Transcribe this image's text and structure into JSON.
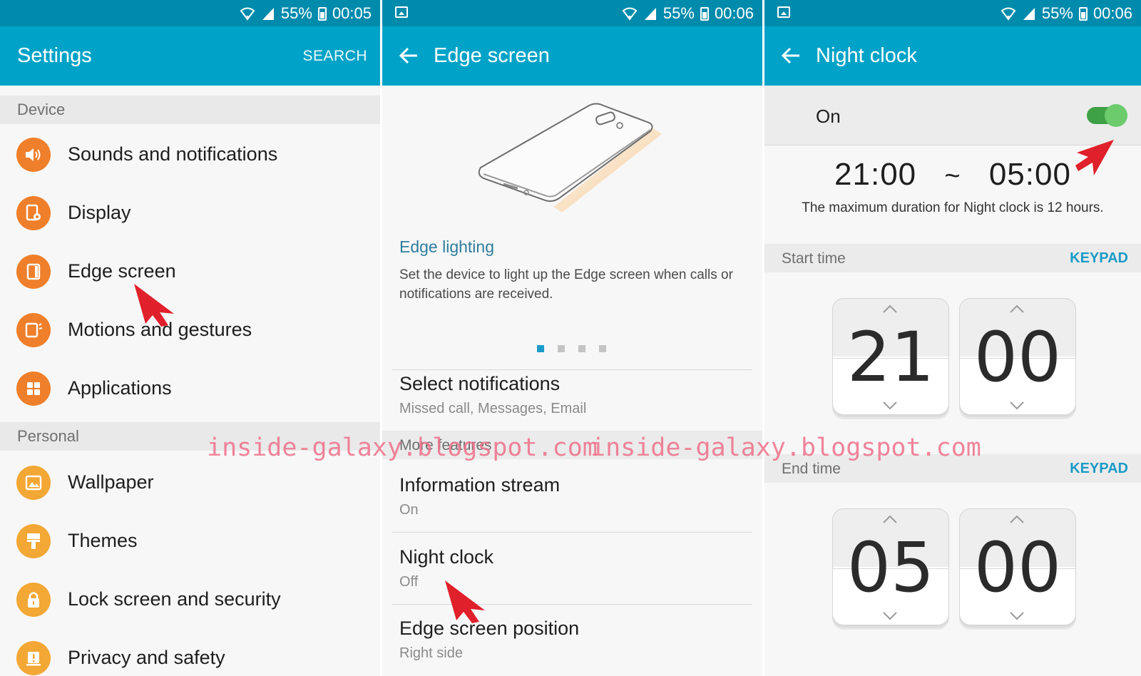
{
  "panels": [
    {
      "status": {
        "battery": "55%",
        "time": "00:05"
      },
      "appbar": {
        "title": "Settings",
        "action": "SEARCH"
      },
      "sections": [
        {
          "header": "Device",
          "items": [
            {
              "label": "Sounds and notifications",
              "icon": "speaker-icon",
              "color": "#ef7f2a"
            },
            {
              "label": "Display",
              "icon": "display-settings-icon",
              "color": "#ef7f2a"
            },
            {
              "label": "Edge screen",
              "icon": "edge-screen-icon",
              "color": "#ef7f2a"
            },
            {
              "label": "Motions and gestures",
              "icon": "motion-icon",
              "color": "#ef7f2a"
            },
            {
              "label": "Applications",
              "icon": "apps-grid-icon",
              "color": "#ef7f2a"
            }
          ]
        },
        {
          "header": "Personal",
          "items": [
            {
              "label": "Wallpaper",
              "icon": "wallpaper-icon",
              "color": "#f3a734"
            },
            {
              "label": "Themes",
              "icon": "paint-roller-icon",
              "color": "#f3a734"
            },
            {
              "label": "Lock screen and security",
              "icon": "lock-icon",
              "color": "#f3a734"
            },
            {
              "label": "Privacy and safety",
              "icon": "alert-icon",
              "color": "#f3a734"
            }
          ]
        }
      ]
    },
    {
      "status": {
        "battery": "55%",
        "time": "00:06"
      },
      "appbar": {
        "title": "Edge screen"
      },
      "feature": {
        "title": "Edge lighting",
        "description": "Set the device to light up the Edge screen when calls or notifications are received."
      },
      "pager": {
        "count": 4,
        "active": 0
      },
      "items": [
        {
          "primary": "Select notifications",
          "secondary": "Missed call, Messages, Email"
        },
        {
          "header": "More features"
        },
        {
          "primary": "Information stream",
          "secondary": "On"
        },
        {
          "primary": "Night clock",
          "secondary": "Off"
        },
        {
          "primary": "Edge screen position",
          "secondary": "Right side"
        }
      ]
    },
    {
      "status": {
        "battery": "55%",
        "time": "00:06"
      },
      "appbar": {
        "title": "Night clock"
      },
      "switch": {
        "label": "On",
        "on": true
      },
      "range": {
        "start": "21:00",
        "separator": "~",
        "end": "05:00",
        "note": "The maximum duration for Night clock is 12 hours."
      },
      "start": {
        "label": "Start time",
        "action": "KEYPAD",
        "hour": "21",
        "minute": "00"
      },
      "end": {
        "label": "End time",
        "action": "KEYPAD",
        "hour": "05",
        "minute": "00"
      }
    }
  ],
  "watermark": "inside-galaxy.blogspot.com",
  "colors": {
    "statusbar": "#008bad",
    "appbar": "#00a3c7",
    "accent": "#1a9bc7",
    "arrow": "#e0202a",
    "toggle": "#6ccc6c"
  }
}
